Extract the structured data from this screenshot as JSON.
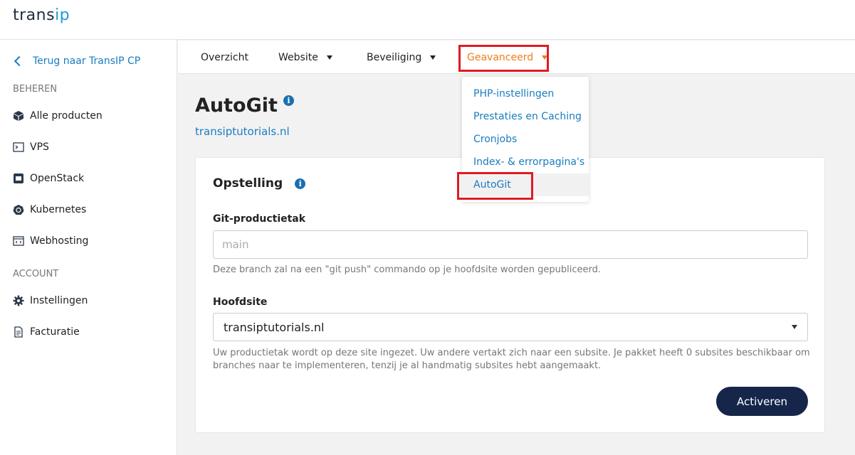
{
  "brand": {
    "part1": "trans",
    "part2": "ip"
  },
  "sidebar": {
    "back_label": "Terug naar TransIP CP",
    "section_manage": "BEHEREN",
    "manage_items": [
      {
        "label": "Alle producten",
        "icon": "cube-icon"
      },
      {
        "label": "VPS",
        "icon": "terminal-icon"
      },
      {
        "label": "OpenStack",
        "icon": "server-icon"
      },
      {
        "label": "Kubernetes",
        "icon": "helm-icon"
      },
      {
        "label": "Webhosting",
        "icon": "code-window-icon"
      }
    ],
    "section_account": "ACCOUNT",
    "account_items": [
      {
        "label": "Instellingen",
        "icon": "gear-icon"
      },
      {
        "label": "Facturatie",
        "icon": "invoice-icon"
      }
    ]
  },
  "nav": {
    "items": [
      {
        "label": "Overzicht"
      },
      {
        "label": "Website"
      },
      {
        "label": "Beveiliging"
      },
      {
        "label": "Geavanceerd"
      }
    ]
  },
  "dropdown": {
    "items": [
      {
        "label": "PHP-instellingen"
      },
      {
        "label": "Prestaties en Caching"
      },
      {
        "label": "Cronjobs"
      },
      {
        "label": "Index- & errorpagina's"
      },
      {
        "label": "AutoGit"
      }
    ]
  },
  "page": {
    "title": "AutoGit",
    "info": "i",
    "domain": "transiptutorials.nl"
  },
  "card": {
    "title": "Opstelling",
    "branch_label": "Git-productietak",
    "branch_placeholder": "main",
    "branch_help": "Deze branch zal na een \"git push\" commando op je hoofdsite worden gepubliceerd.",
    "site_label": "Hoofdsite",
    "site_value": "transiptutorials.nl",
    "site_help": "Uw productietak wordt op deze site ingezet. Uw andere vertakt zich naar een subsite. Je pakket heeft 0 subsites beschikbaar om branches naar te implementeren, tenzij je al handmatig subsites hebt aangemaakt.",
    "button": "Activeren"
  },
  "colors": {
    "accent_orange": "#ef7d1a",
    "link_blue": "#1a7cbf",
    "highlight_red": "#e01b22",
    "button_navy": "#16264a"
  }
}
